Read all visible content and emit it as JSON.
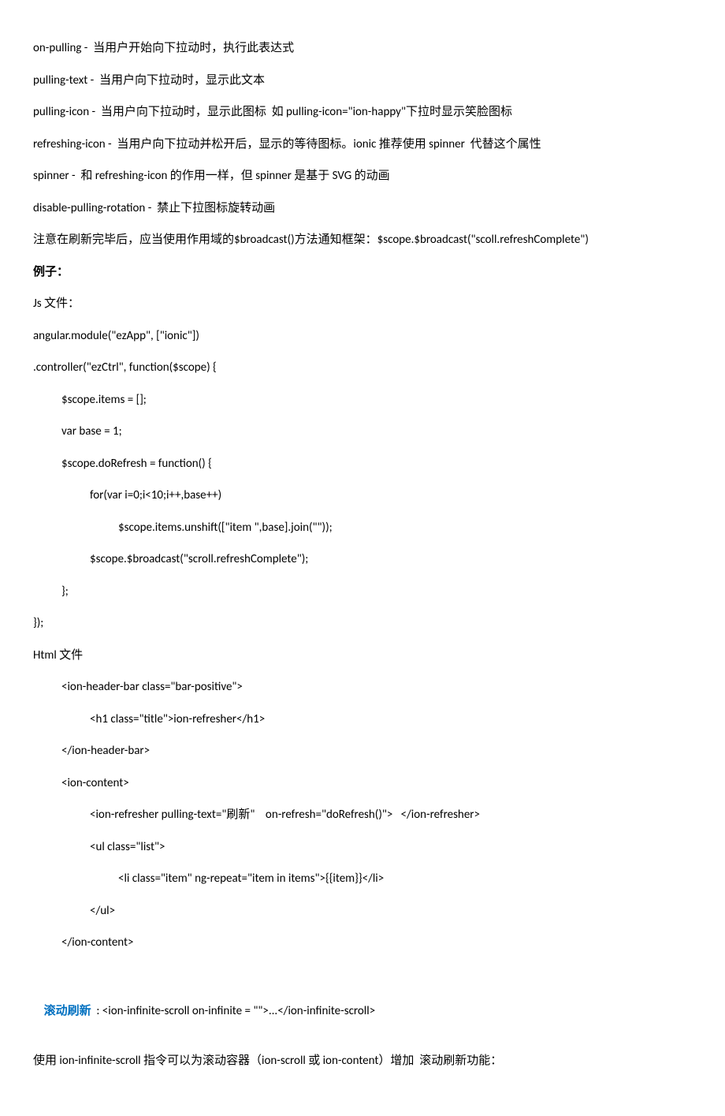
{
  "lines": [
    {
      "cls": "para",
      "text": "on-pulling -  当用户开始向下拉动时，执行此表达式"
    },
    {
      "cls": "para",
      "text": "pulling-text -  当用户向下拉动时，显示此文本"
    },
    {
      "cls": "para",
      "text": "pulling-icon -  当用户向下拉动时，显示此图标  如 pulling-icon=\"ion-happy\"下拉时显示笑脸图标"
    },
    {
      "cls": "para",
      "text": "refreshing-icon -  当用户向下拉动并松开后，显示的等待图标。ionic 推荐使用 spinner  代替这个属性"
    },
    {
      "cls": "para",
      "text": "spinner -  和 refreshing-icon 的作用一样，但 spinner 是基于 SVG 的动画"
    },
    {
      "cls": "para",
      "text": "disable-pulling-rotation -  禁止下拉图标旋转动画"
    },
    {
      "cls": "para",
      "text": "注意在刷新完毕后，应当使用作用域的$broadcast()方法通知框架：$scope.$broadcast(\"scoll.refreshComplete\")"
    },
    {
      "cls": "para bold",
      "text": "例子："
    },
    {
      "cls": "para",
      "text": "Js 文件："
    },
    {
      "cls": "para",
      "text": "angular.module(\"ezApp\", [\"ionic\"])"
    },
    {
      "cls": "para",
      "text": ".controller(\"ezCtrl\", function($scope) {"
    },
    {
      "cls": "para indent1",
      "text": "$scope.items = [];"
    },
    {
      "cls": "para indent1",
      "text": "var base = 1;"
    },
    {
      "cls": "para indent1",
      "text": "$scope.doRefresh = function() {"
    },
    {
      "cls": "para indent2",
      "text": "for(var i=0;i<10;i++,base++)"
    },
    {
      "cls": "para indent3",
      "text": "$scope.items.unshift([\"item \",base].join(\"\"));"
    },
    {
      "cls": "para indent2",
      "text": "$scope.$broadcast(\"scroll.refreshComplete\");"
    },
    {
      "cls": "para indent1",
      "text": "};"
    },
    {
      "cls": "para",
      "text": "});"
    },
    {
      "cls": "para",
      "text": "Html 文件"
    },
    {
      "cls": "para indent1",
      "text": "<ion-header-bar class=\"bar-positive\">"
    },
    {
      "cls": "para indent2",
      "text": "<h1 class=\"title\">ion-refresher</h1>"
    },
    {
      "cls": "para indent1",
      "text": "</ion-header-bar>"
    },
    {
      "cls": "para indent1",
      "text": "<ion-content>"
    },
    {
      "cls": "para indent2",
      "text": "<ion-refresher pulling-text=\"刷新\"    on-refresh=\"doRefresh()\">   </ion-refresher>"
    },
    {
      "cls": "para indent2",
      "text": "<ul class=\"list\">"
    },
    {
      "cls": "para indent3",
      "text": "<li class=\"item\" ng-repeat=\"item in items\">{{item}}</li>"
    },
    {
      "cls": "para indent2",
      "text": "</ul>"
    },
    {
      "cls": "para indent1 bigspacer",
      "text": "</ion-content>"
    }
  ],
  "scroll_title": "滚动刷新",
  "scroll_rest": "  : <ion-infinite-scroll on-infinite = \"\">...</ion-infinite-scroll>",
  "last_line": "使用 ion-infinite-scroll 指令可以为滚动容器（ion-scroll 或 ion-content）增加  滚动刷新功能："
}
